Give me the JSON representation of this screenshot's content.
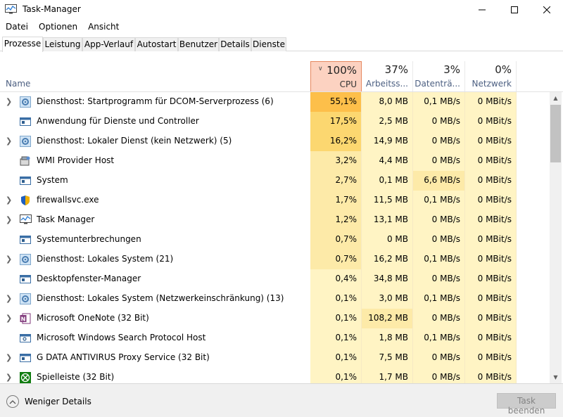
{
  "window": {
    "title": "Task-Manager",
    "icon": "task-manager-icon",
    "controls": [
      "minimize-icon",
      "maximize-icon",
      "close-icon"
    ]
  },
  "menu": [
    "Datei",
    "Optionen",
    "Ansicht"
  ],
  "tabs": [
    {
      "label": "Prozesse",
      "active": true
    },
    {
      "label": "Leistung",
      "active": false
    },
    {
      "label": "App-Verlauf",
      "active": false
    },
    {
      "label": "Autostart",
      "active": false
    },
    {
      "label": "Benutzer",
      "active": false
    },
    {
      "label": "Details",
      "active": false
    },
    {
      "label": "Dienste",
      "active": false
    }
  ],
  "header": {
    "name_label": "Name",
    "cpu": {
      "percent": "100%",
      "label": "CPU"
    },
    "memory": {
      "percent": "37%",
      "label": "Arbeitss..."
    },
    "disk": {
      "percent": "3%",
      "label": "Datenträ..."
    },
    "network": {
      "percent": "0%",
      "label": "Netzwerk"
    }
  },
  "processes": [
    {
      "name": "Diensthost: Startprogramm für DCOM-Serverprozess (6)",
      "icon": "gear-icon",
      "expandable": true,
      "cpu": "55,1%",
      "memory": "8,0 MB",
      "disk": "0,1 MB/s",
      "network": "0 MBit/s"
    },
    {
      "name": "Anwendung für Dienste und Controller",
      "icon": "window-icon",
      "expandable": false,
      "cpu": "17,5%",
      "memory": "2,5 MB",
      "disk": "0 MB/s",
      "network": "0 MBit/s"
    },
    {
      "name": "Diensthost: Lokaler Dienst (kein Netzwerk) (5)",
      "icon": "gear-icon",
      "expandable": true,
      "cpu": "16,2%",
      "memory": "14,9 MB",
      "disk": "0 MB/s",
      "network": "0 MBit/s"
    },
    {
      "name": "WMI Provider Host",
      "icon": "wmi-icon",
      "expandable": false,
      "cpu": "3,2%",
      "memory": "4,4 MB",
      "disk": "0 MB/s",
      "network": "0 MBit/s"
    },
    {
      "name": "System",
      "icon": "window-icon",
      "expandable": false,
      "cpu": "2,7%",
      "memory": "0,1 MB",
      "disk": "6,6 MB/s",
      "network": "0 MBit/s"
    },
    {
      "name": "firewallsvc.exe",
      "icon": "shield-icon",
      "expandable": true,
      "cpu": "1,7%",
      "memory": "11,5 MB",
      "disk": "0,1 MB/s",
      "network": "0 MBit/s"
    },
    {
      "name": "Task Manager",
      "icon": "task-manager-icon",
      "expandable": true,
      "cpu": "1,2%",
      "memory": "13,1 MB",
      "disk": "0 MB/s",
      "network": "0 MBit/s"
    },
    {
      "name": "Systemunterbrechungen",
      "icon": "window-icon",
      "expandable": false,
      "cpu": "0,7%",
      "memory": "0 MB",
      "disk": "0 MB/s",
      "network": "0 MBit/s"
    },
    {
      "name": "Diensthost: Lokales System (21)",
      "icon": "gear-icon",
      "expandable": true,
      "cpu": "0,7%",
      "memory": "16,2 MB",
      "disk": "0,1 MB/s",
      "network": "0 MBit/s"
    },
    {
      "name": "Desktopfenster-Manager",
      "icon": "window-icon",
      "expandable": false,
      "cpu": "0,4%",
      "memory": "34,8 MB",
      "disk": "0 MB/s",
      "network": "0 MBit/s"
    },
    {
      "name": "Diensthost: Lokales System (Netzwerkeinschränkung) (13)",
      "icon": "gear-icon",
      "expandable": true,
      "cpu": "0,1%",
      "memory": "3,0 MB",
      "disk": "0,1 MB/s",
      "network": "0 MBit/s"
    },
    {
      "name": "Microsoft OneNote (32 Bit)",
      "icon": "onenote-icon",
      "expandable": true,
      "cpu": "0,1%",
      "memory": "108,2 MB",
      "disk": "0 MB/s",
      "network": "0 MBit/s"
    },
    {
      "name": "Microsoft Windows Search Protocol Host",
      "icon": "search-host-icon",
      "expandable": false,
      "cpu": "0,1%",
      "memory": "1,8 MB",
      "disk": "0,1 MB/s",
      "network": "0 MBit/s"
    },
    {
      "name": "G DATA ANTIVIRUS Proxy Service (32 Bit)",
      "icon": "window-icon",
      "expandable": true,
      "cpu": "0,1%",
      "memory": "7,5 MB",
      "disk": "0 MB/s",
      "network": "0 MBit/s"
    },
    {
      "name": "Spielleiste (32 Bit)",
      "icon": "xbox-icon",
      "expandable": true,
      "cpu": "0,1%",
      "memory": "1,7 MB",
      "disk": "0 MB/s",
      "network": "0 MBit/s"
    }
  ],
  "footer": {
    "fewer_details": "Weniger Details",
    "end_task": "Task beenden"
  },
  "colors": {
    "cpu_header_bg": "#fcd2c1",
    "cpu_header_border": "#e6875f",
    "heat_high": "#fdbf4a",
    "heat_mid": "#fcd770",
    "heat_low": "#fdeaa8",
    "heat_base": "#fff4c4",
    "accent_text": "#4d6082"
  }
}
